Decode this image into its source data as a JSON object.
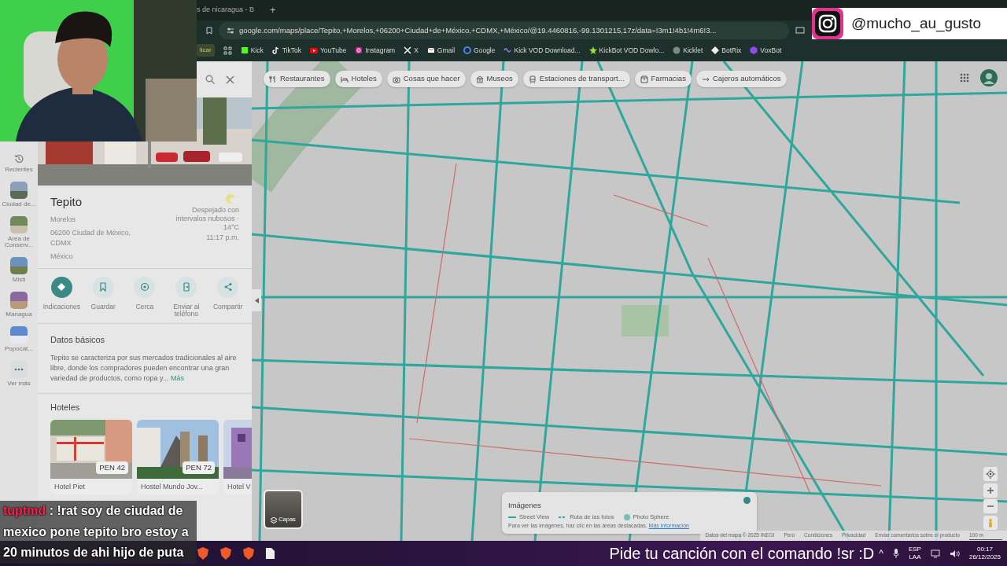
{
  "browser": {
    "tab_title": "s de nicaragua - B",
    "new_tab": "+",
    "url": "google.com/maps/place/Tepito,+Morelos,+06200+Ciudad+de+México,+CDMX,+México/@19.4460816,-99.1301215,17z/data=!3m1!4b1!4m6!3..."
  },
  "bookmarks": [
    {
      "label": "licar",
      "kind": "chip"
    },
    {
      "label": "Kick",
      "kind": "kick"
    },
    {
      "label": "TikTok",
      "kind": "tiktok"
    },
    {
      "label": "YouTube",
      "kind": "youtube"
    },
    {
      "label": "Instagram",
      "kind": "instagram"
    },
    {
      "label": "X",
      "kind": "x"
    },
    {
      "label": "Gmail",
      "kind": "gmail"
    },
    {
      "label": "Google",
      "kind": "google"
    },
    {
      "label": "Kick VOD Download...",
      "kind": "vod"
    },
    {
      "label": "KickBot VOD Dowlo...",
      "kind": "bot"
    },
    {
      "label": "Kicklet",
      "kind": "kicklet"
    },
    {
      "label": "BotRix",
      "kind": "botrix"
    },
    {
      "label": "VoxBot",
      "kind": "voxbot"
    }
  ],
  "social_overlay": {
    "handle": "@mucho_au_gusto"
  },
  "rail": [
    {
      "label": "Recientes",
      "kind": "history"
    },
    {
      "label": "Ciudad de...",
      "kind": "place"
    },
    {
      "label": "Area de Conserv...",
      "kind": "place"
    },
    {
      "label": "Misti",
      "kind": "place"
    },
    {
      "label": "Managua",
      "kind": "place"
    },
    {
      "label": "Popocat...",
      "kind": "place"
    },
    {
      "label": "Ver más",
      "kind": "more"
    }
  ],
  "place": {
    "name": "Tepito",
    "address": [
      "Morelos",
      "06200 Ciudad de México, CDMX",
      "México"
    ],
    "weather": "Despejado con intervalos nubosos · 14°C",
    "time": "11:17 p.m."
  },
  "actions": [
    {
      "label": "Indicaciones",
      "kind": "directions"
    },
    {
      "label": "Guardar",
      "kind": "save"
    },
    {
      "label": "Cerca",
      "kind": "nearby"
    },
    {
      "label": "Enviar al teléfono",
      "kind": "phone"
    },
    {
      "label": "Compartir",
      "kind": "share"
    }
  ],
  "about": {
    "title": "Datos básicos",
    "text": "Tepito se caracteriza por sus mercados tradicionales al aire libre, donde los compradores pueden encontrar una gran variedad de productos, como ropa y...",
    "more": "Más"
  },
  "hotels": {
    "title": "Hoteles",
    "items": [
      {
        "name": "Hotel Piet",
        "price": "PEN 42"
      },
      {
        "name": "Hostel Mundo Jov...",
        "price": "PEN 72"
      },
      {
        "name": "Hotel V"
      }
    ]
  },
  "map": {
    "chips": [
      {
        "label": "Restaurantes",
        "kind": "restaurant"
      },
      {
        "label": "Hoteles",
        "kind": "hotel"
      },
      {
        "label": "Cosas que hacer",
        "kind": "camera"
      },
      {
        "label": "Museos",
        "kind": "museum"
      },
      {
        "label": "Estaciones de transport...",
        "kind": "transit"
      },
      {
        "label": "Farmacias",
        "kind": "pharmacy"
      },
      {
        "label": "Cajeros automáticos",
        "kind": "atm"
      }
    ],
    "layers": "Capas",
    "imagery": {
      "title": "Imágenes",
      "legend": [
        {
          "label": "Street View",
          "kind": "line"
        },
        {
          "label": "Ruta de las fotos",
          "kind": "dashed"
        },
        {
          "label": "Photo Sphere",
          "kind": "dot"
        }
      ],
      "hint": "Para ver las imágenes, haz clic en las áreas destacadas.",
      "link": "Más información"
    },
    "footer": [
      "Datos del mapa © 2025 INEGI",
      "Perú",
      "Condiciones",
      "Privacidad",
      "Enviar comentarios sobre el producto"
    ],
    "scale": "100 m"
  },
  "chat": {
    "user": "tuptmd",
    "message": " : !rat soy de ciudad de mexico pone tepito bro estoy a 20 minutos de ahi hijo de puta"
  },
  "taskbar": {
    "ticker": "Pide tu canción con el comando !sr :D",
    "chevron": "^",
    "lang": "ESP",
    "layout": "LAA",
    "time": "00:17",
    "date": "26/12/2025"
  }
}
